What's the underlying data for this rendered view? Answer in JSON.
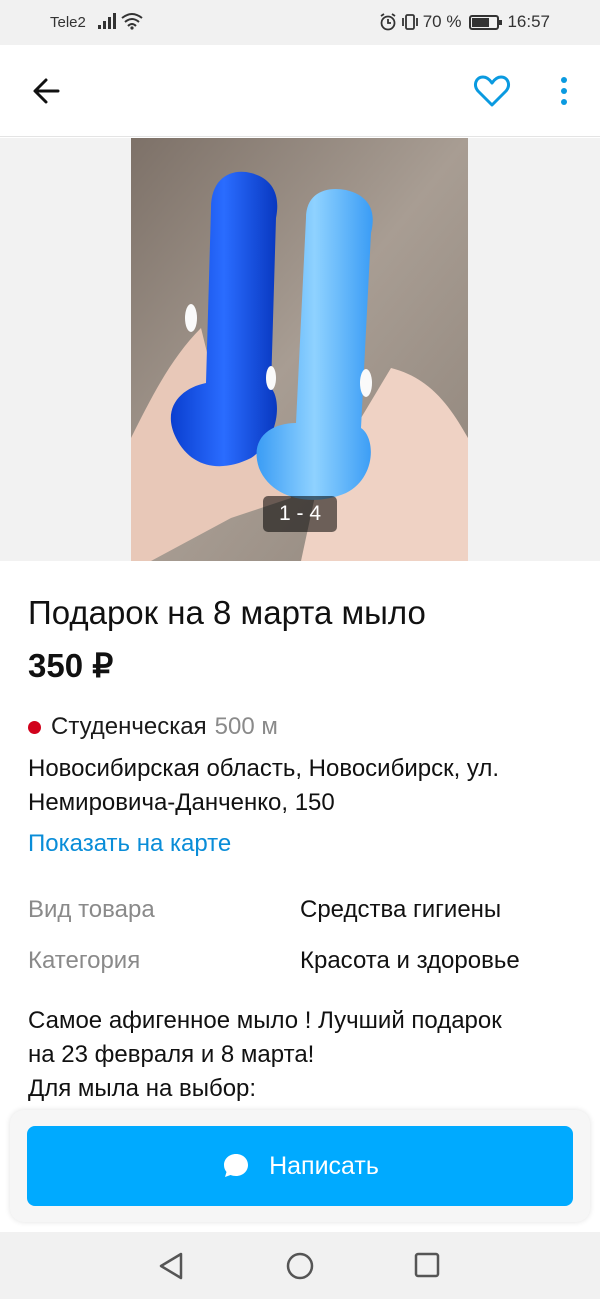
{
  "status": {
    "carrier": "Tele2",
    "battery_text": "70 %",
    "battery_level": 0.7,
    "time": "16:57"
  },
  "gallery": {
    "counter": "1 - 4"
  },
  "listing": {
    "title": "Подарок на 8 марта мыло",
    "price": "350 ₽",
    "metro_station": "Студенческая",
    "metro_distance": "500 м",
    "address": "Новосибирская область, Новосибирск, ул. Немировича-Данченко, 150",
    "map_link": "Показать на карте",
    "attributes": [
      {
        "key": "Вид товара",
        "value": "Средства гигиены"
      },
      {
        "key": "Категория",
        "value": "Красота и здоровье"
      }
    ],
    "description_lines": [
      "Самое афигенное мыло ! Лучший подарок",
      "на 23 февраля и 8 марта!",
      "Для мыла на выбор:"
    ]
  },
  "actions": {
    "write_label": "Написать"
  },
  "colors": {
    "accent": "#00aaff",
    "link": "#0a8dd8",
    "metro": "#d1021c"
  }
}
